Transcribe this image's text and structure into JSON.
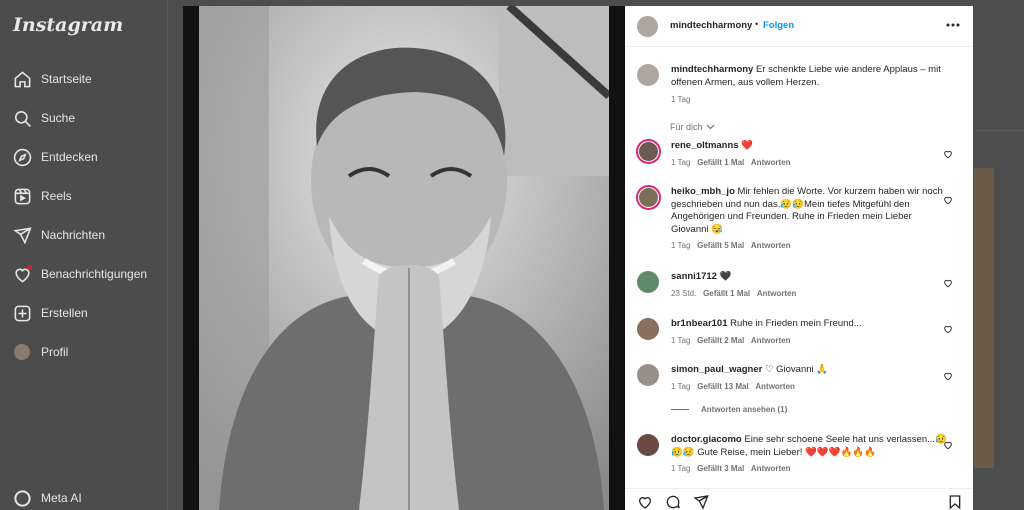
{
  "app": {
    "logo_text": "Instagram"
  },
  "sidebar": {
    "items": [
      {
        "label": "Startseite",
        "icon": "home-icon"
      },
      {
        "label": "Suche",
        "icon": "search-icon"
      },
      {
        "label": "Entdecken",
        "icon": "compass-icon"
      },
      {
        "label": "Reels",
        "icon": "reels-icon"
      },
      {
        "label": "Nachrichten",
        "icon": "send-icon"
      },
      {
        "label": "Benachrichtigungen",
        "icon": "heart-icon"
      },
      {
        "label": "Erstellen",
        "icon": "plus-icon"
      },
      {
        "label": "Profil",
        "icon": "avatar"
      },
      {
        "label": "Meta AI",
        "icon": "meta-ai-icon"
      }
    ]
  },
  "post": {
    "author": "mindtechharmony",
    "separator": "•",
    "follow_label": "Folgen",
    "more_icon": "more-icon",
    "caption": "Er schenkte Liebe wie andere Applaus – mit offenen Armen, aus vollem Herzen.",
    "caption_time": "1 Tag",
    "sort_label": "Für dich"
  },
  "comments": [
    {
      "user": "rene_oltmanns",
      "text": "❤️",
      "time": "1 Tag",
      "likes": "Gefällt 1 Mal",
      "reply": "Antworten"
    },
    {
      "user": "heiko_mbh_jo",
      "text": "Mir fehlen die Worte. Vor kurzem haben wir noch geschrieben und nun das.😥😥Mein tiefes Mitgefühl den Angehörigen und Freunden. Ruhe in Frieden mein Lieber Giovanni 😪",
      "time": "1 Tag",
      "likes": "Gefällt 5 Mal",
      "reply": "Antworten"
    },
    {
      "user": "sanni1712",
      "text": "🖤",
      "time": "23 Std.",
      "likes": "Gefällt 1 Mal",
      "reply": "Antworten"
    },
    {
      "user": "br1nbear101",
      "text": "Ruhe in Frieden mein Freund...",
      "time": "1 Tag",
      "likes": "Gefällt 2 Mal",
      "reply": "Antworten"
    },
    {
      "user": "simon_paul_wagner",
      "text": "♡ Giovanni 🙏",
      "time": "1 Tag",
      "likes": "Gefällt 13 Mal",
      "reply": "Antworten",
      "view_replies": "Antworten ansehen (1)"
    },
    {
      "user": "doctor.giacomo",
      "text": "Eine sehr schoene Seele hat uns verlassen...😥😥😥 Gute Reise, mein Lieber! ❤️❤️❤️🔥🔥🔥",
      "time": "1 Tag",
      "likes": "Gefällt 3 Mal",
      "reply": "Antworten"
    }
  ],
  "actions": {
    "like_icon": "heart-icon",
    "comment_icon": "comment-icon",
    "share_icon": "send-icon",
    "save_icon": "bookmark-icon"
  },
  "colors": {
    "follow": "#0095f6",
    "ring": "#d62976",
    "backdrop": "#4d4d4d"
  }
}
